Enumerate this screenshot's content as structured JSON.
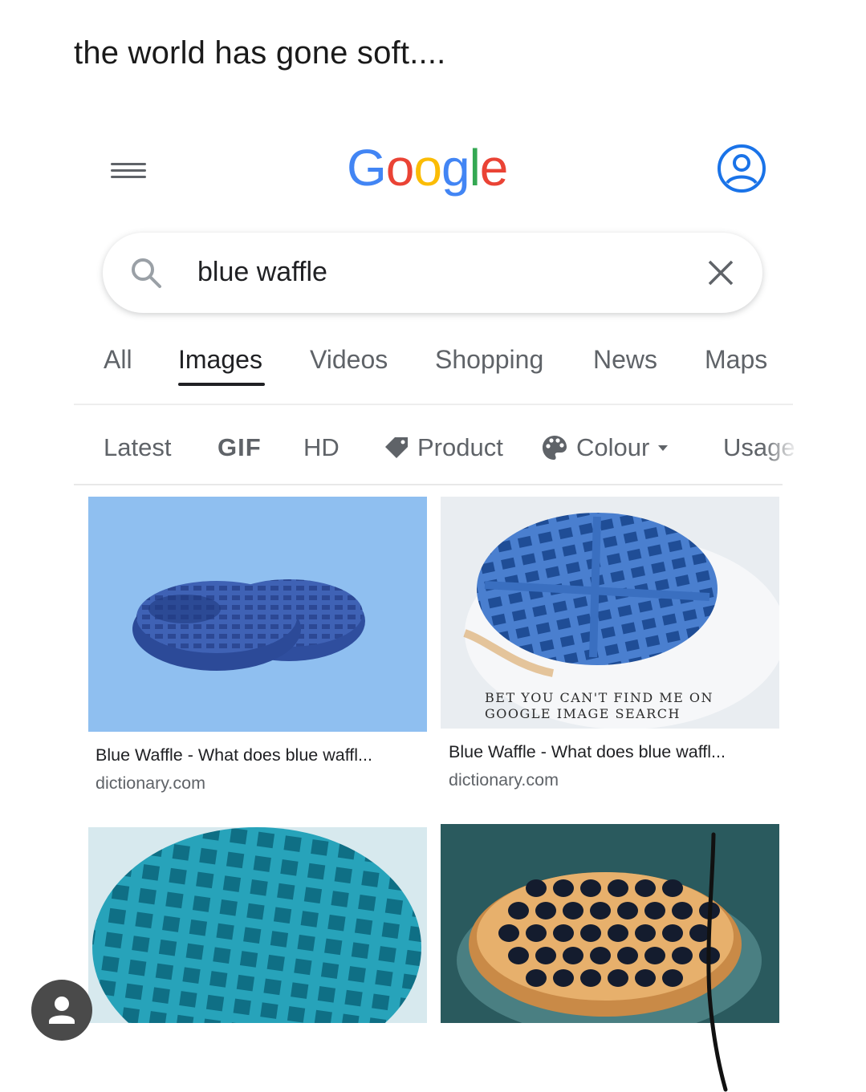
{
  "post": {
    "caption": "the world has gone soft...."
  },
  "header": {
    "logo_letters": [
      {
        "ch": "G",
        "color": "#4285f4"
      },
      {
        "ch": "o",
        "color": "#ea4335"
      },
      {
        "ch": "o",
        "color": "#fbbc05"
      },
      {
        "ch": "g",
        "color": "#4285f4"
      },
      {
        "ch": "l",
        "color": "#34a853"
      },
      {
        "ch": "e",
        "color": "#ea4335"
      }
    ],
    "menu_icon": "hamburger-menu-icon",
    "account_icon": "account-circle-icon"
  },
  "search": {
    "value": "blue waffle",
    "search_icon": "search-icon",
    "clear_icon": "close-icon"
  },
  "tabs": {
    "items": [
      {
        "label": "All"
      },
      {
        "label": "Images"
      },
      {
        "label": "Videos"
      },
      {
        "label": "Shopping"
      },
      {
        "label": "News"
      },
      {
        "label": "Maps"
      }
    ],
    "active": "Images"
  },
  "filters": {
    "latest": "Latest",
    "gif": "GIF",
    "hd": "HD",
    "product": "Product",
    "colour": "Colour",
    "usage": "Usage"
  },
  "results": [
    {
      "title": "Blue Waffle - What does blue waffl...",
      "source": "dictionary.com"
    },
    {
      "title": "Blue Waffle - What does blue waffl...",
      "source": "dictionary.com",
      "watermark": [
        "BET YOU CAN'T FIND ME ON",
        "GOOGLE IMAGE SEARCH"
      ]
    },
    {
      "title": "",
      "source": ""
    },
    {
      "title": "",
      "source": ""
    }
  ],
  "colors": {
    "accent_blue": "#1a73e8",
    "text_dark": "#202124",
    "text_muted": "#5f6368"
  }
}
